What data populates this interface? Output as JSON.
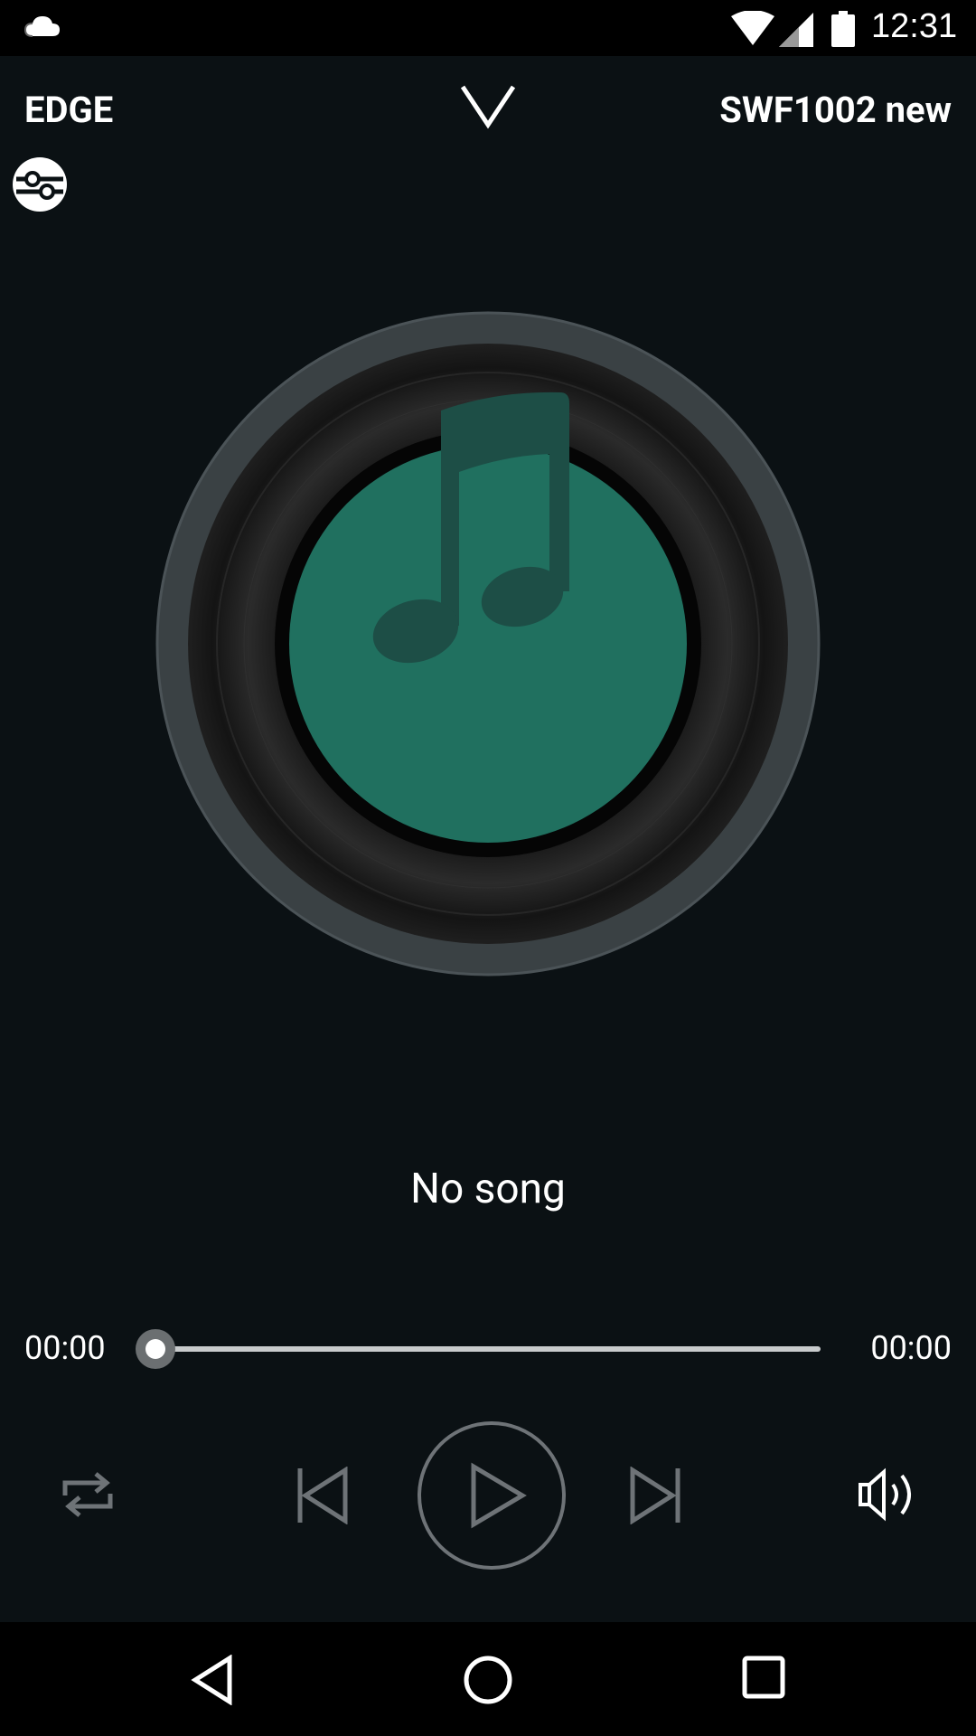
{
  "status_bar": {
    "time": "12:31",
    "icons": [
      "cloud-icon",
      "wifi-icon",
      "signal-icon",
      "battery-icon"
    ]
  },
  "header": {
    "left_label": "EDGE",
    "right_label": "SWF1002 new",
    "collapse_icon": "chevron-down-icon",
    "eq_icon": "equalizer-icon"
  },
  "player": {
    "song_title": "No song",
    "elapsed": "00:00",
    "duration": "00:00",
    "progress": 0,
    "album_icon": "music-note-icon",
    "accent_color": "#20705f"
  },
  "controls": [
    "repeat-icon",
    "previous-icon",
    "play-icon",
    "next-icon",
    "volume-icon"
  ],
  "nav_bar": [
    "back-icon",
    "home-icon",
    "recents-icon"
  ]
}
